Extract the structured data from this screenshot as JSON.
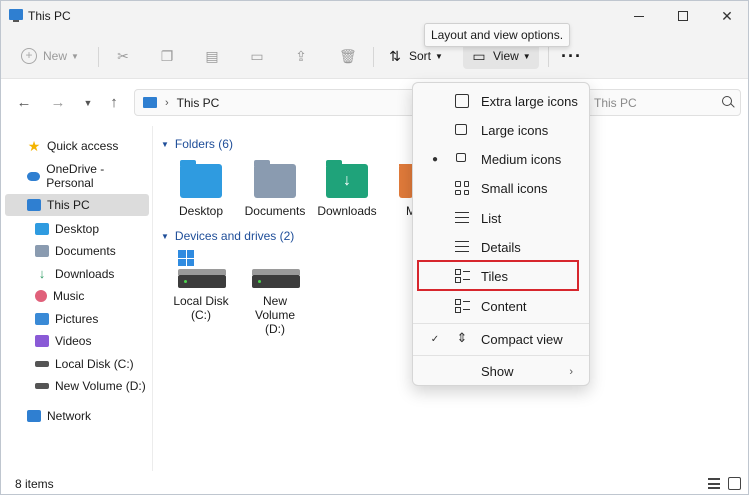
{
  "window": {
    "title": "This PC"
  },
  "toolbar": {
    "new_label": "New",
    "sort_label": "Sort",
    "view_label": "View",
    "more_label": "···",
    "tooltip": "Layout and view options."
  },
  "address": {
    "path": "This PC",
    "search_placeholder": "Search This PC",
    "search_visible": "This PC"
  },
  "sidebar": {
    "items": [
      {
        "label": "Quick access",
        "icon": "star-icon"
      },
      {
        "label": "OneDrive - Personal",
        "icon": "cloud-icon"
      },
      {
        "label": "This PC",
        "icon": "computer-icon",
        "selected": true
      },
      {
        "label": "Desktop",
        "icon": "desktop-folder-icon"
      },
      {
        "label": "Documents",
        "icon": "documents-folder-icon"
      },
      {
        "label": "Downloads",
        "icon": "downloads-icon"
      },
      {
        "label": "Music",
        "icon": "music-icon"
      },
      {
        "label": "Pictures",
        "icon": "pictures-icon"
      },
      {
        "label": "Videos",
        "icon": "videos-icon"
      },
      {
        "label": "Local Disk (C:)",
        "icon": "disk-icon"
      },
      {
        "label": "New Volume (D:)",
        "icon": "disk-icon"
      },
      {
        "label": "Network",
        "icon": "network-icon"
      }
    ]
  },
  "main": {
    "folders_header": "Folders (6)",
    "folders": [
      {
        "label": "Desktop",
        "icon": "desktop-folder-icon"
      },
      {
        "label": "Documents",
        "icon": "documents-folder-icon"
      },
      {
        "label": "Downloads",
        "icon": "downloads-folder-icon"
      },
      {
        "label": "M",
        "icon": "music-folder-icon"
      }
    ],
    "drives_header": "Devices and drives (2)",
    "drives": [
      {
        "label_line1": "Local Disk",
        "label_line2": "(C:)",
        "icon": "windows-drive-icon"
      },
      {
        "label_line1": "New",
        "label_line2": "Volume",
        "label_line3": "(D:)",
        "icon": "drive-icon"
      }
    ]
  },
  "status": {
    "count": "8 items"
  },
  "view_menu": {
    "items": [
      {
        "label": "Extra large icons",
        "icon": "extra-large-icons-icon"
      },
      {
        "label": "Large icons",
        "icon": "large-icons-icon"
      },
      {
        "label": "Medium icons",
        "icon": "medium-icons-icon",
        "selected": true
      },
      {
        "label": "Small icons",
        "icon": "small-icons-icon"
      },
      {
        "label": "List",
        "icon": "list-icon"
      },
      {
        "label": "Details",
        "icon": "details-icon"
      },
      {
        "label": "Tiles",
        "icon": "tiles-icon",
        "highlighted": true
      },
      {
        "label": "Content",
        "icon": "content-icon"
      },
      {
        "label": "Compact view",
        "icon": "compact-view-icon",
        "checked": true
      },
      {
        "label": "Show",
        "icon": "submenu-arrow"
      }
    ],
    "highlight_color": "#d7262d"
  }
}
